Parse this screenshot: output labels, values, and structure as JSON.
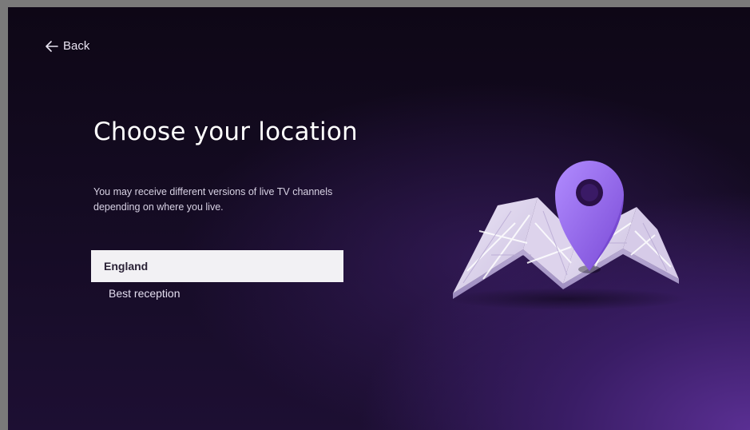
{
  "nav": {
    "back_label": "Back",
    "back_icon": "arrow-left-icon"
  },
  "page": {
    "title": "Choose your location",
    "description": "You may receive different versions of live TV channels depending on where you live."
  },
  "location_list": {
    "items": [
      {
        "label": "England",
        "sublabel": "Best reception",
        "selected": true
      }
    ]
  },
  "illustration": {
    "icon": "map-pin-icon",
    "map_icon": "folded-map-icon"
  },
  "colors": {
    "background_dark": "#0e0716",
    "background_accent": "#5a2f93",
    "pin_purple": "#9b6cf0",
    "selected_item_bg": "#f2f1f4",
    "selected_item_text": "#2a2236"
  }
}
